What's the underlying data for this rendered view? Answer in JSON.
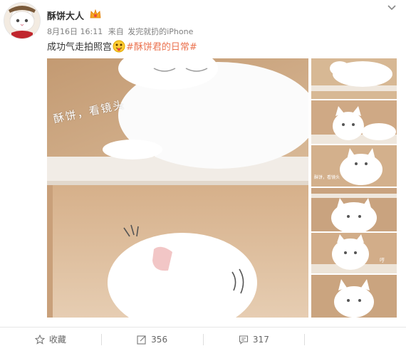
{
  "post": {
    "username": "酥饼大人",
    "date": "8月16日 16:11",
    "source_prefix": "来自",
    "source": "发完就扔的iPhone",
    "text": "成功气走拍照宫",
    "hashtag": "#酥饼君的日常#"
  },
  "photo": {
    "caption_main": "酥饼，看镜头",
    "thumb_caption_1": "酥饼，看镜头",
    "thumb_caption_2": "哼"
  },
  "actions": {
    "favorite_label": "收藏",
    "repost_count": "356",
    "comment_count": "317"
  },
  "colors": {
    "hashtag": "#eb7350",
    "wood": "#c8a27c",
    "shelf": "#f3eee8"
  }
}
